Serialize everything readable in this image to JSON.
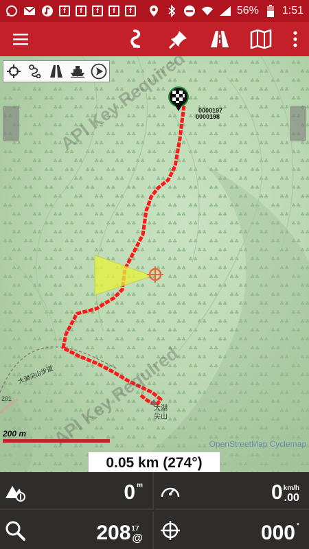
{
  "status_bar": {
    "battery": "56%",
    "time": "1:51",
    "left_icons": [
      "whatsapp-icon",
      "mail-icon",
      "music-icon",
      "facebook-icon",
      "facebook-icon",
      "facebook-icon",
      "facebook-icon",
      "facebook-icon"
    ],
    "right_icons": [
      "location-icon",
      "bluetooth-icon",
      "do-not-disturb-icon",
      "wifi-icon",
      "signal-icon",
      "battery-icon"
    ]
  },
  "toolbar": {
    "icons": [
      "menu-icon",
      "route-icon",
      "pin-icon",
      "road-icon",
      "map-icon",
      "more-vert-icon"
    ]
  },
  "map": {
    "watermark": "API Key Required",
    "waypoint_label_1": "0000197",
    "waypoint_label_2": "0000198",
    "place_name_1": "大湖",
    "place_name_2": "尖山",
    "trail_name": "大湖尖山步道",
    "road_number": "201",
    "scale_label": "200 m",
    "attribution": "OpenStreetMap Cyclemap",
    "distance_readout": "0.05 km (274°)",
    "floating_tools": [
      "target-icon",
      "route-icon",
      "road-icon",
      "ferry-icon",
      "navigate-icon"
    ]
  },
  "dashboard": {
    "elevation": {
      "value": "0",
      "unit": "m",
      "icon": "elevation-icon"
    },
    "speed": {
      "value": "0",
      "decimals": ".00",
      "unit": "km/h",
      "icon": "speedometer-icon"
    },
    "accuracy": {
      "value": "208",
      "sup": "17",
      "sub": "@",
      "icon": "search-icon"
    },
    "bearing": {
      "value": "000",
      "unit": "°",
      "icon": "crosshair-icon"
    }
  },
  "colors": {
    "statusbar": "#b0141e",
    "toolbar": "#c4202a",
    "track": "#ff1a1a",
    "dashboard": "#2f2c2c"
  }
}
